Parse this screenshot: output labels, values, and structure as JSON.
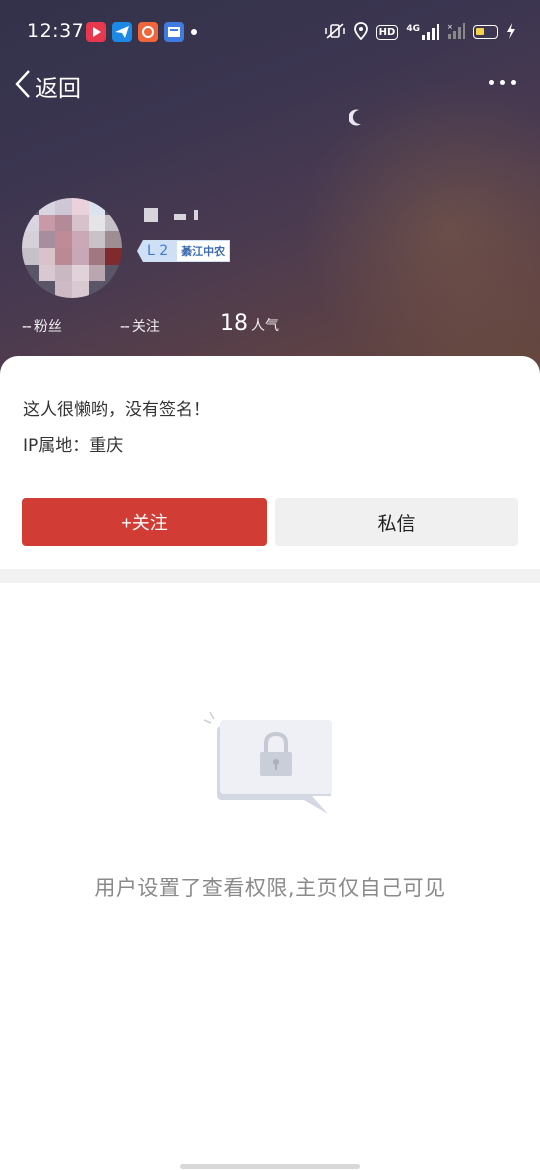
{
  "status_bar": {
    "time": "12:37",
    "network": "4G",
    "hd": "HD",
    "app_icons": [
      {
        "name": "video-app-icon",
        "color": "#e8384f"
      },
      {
        "name": "send-app-icon",
        "color": "#1e88e5"
      },
      {
        "name": "shopping-app-icon",
        "color": "#f0663a"
      },
      {
        "name": "news-app-icon",
        "color": "#3f7be0"
      }
    ]
  },
  "nav": {
    "back_label": "返回"
  },
  "profile": {
    "level": "L 2",
    "tag": "綦江中农",
    "stats": [
      {
        "value": "--",
        "label": "粉丝"
      },
      {
        "value": "--",
        "label": "关注"
      },
      {
        "value": "18",
        "label": "人气"
      }
    ],
    "bio": "这人很懒哟，没有签名！",
    "ip_location": "IP属地：重庆"
  },
  "actions": {
    "follow_label": "+关注",
    "message_label": "私信"
  },
  "empty_state": {
    "icon": "lock-icon",
    "message": "用户设置了查看权限,主页仅自己可见"
  },
  "colors": {
    "accent": "#d13c34",
    "level_badge": "#cfe0f5"
  }
}
